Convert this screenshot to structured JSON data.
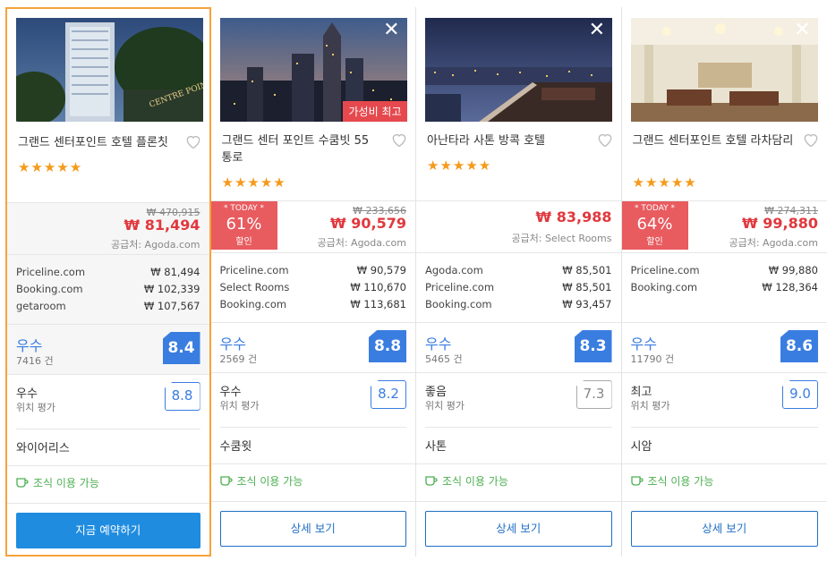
{
  "hotels": [
    {
      "name": "그랜드 센터포인트 호텔 플론칫",
      "stars": "★★★★★",
      "old_price": "₩ 470,915",
      "price": "₩ 81,494",
      "supplier": "공급처: Agoda.com",
      "today": null,
      "alts": [
        {
          "site": "Priceline.com",
          "price": "₩   81,494"
        },
        {
          "site": "Booking.com",
          "price": "₩  102,339"
        },
        {
          "site": "getaroom",
          "price": "₩  107,567"
        }
      ],
      "rating_label": "우수",
      "rating_count": "7416 건",
      "rating_score": "8.4",
      "location_label": "우수",
      "location_sub": "위치 평가",
      "location_score": "8.8",
      "area": "와이어리스",
      "breakfast": "조식 이용 가능",
      "button": "지금 예약하기",
      "photo": "hotel-tower-night"
    },
    {
      "name": "그랜드 센터 포인트 수쿰빗 55 통로",
      "stars": "★★★★★",
      "old_price": "₩ 233,656",
      "price": "₩ 90,579",
      "supplier": "공급처: Agoda.com",
      "badge": "가성비 최고",
      "today": {
        "top": "* TODAY *",
        "pct": "61%",
        "label": "할인"
      },
      "alts": [
        {
          "site": "Priceline.com",
          "price": "₩   90,579"
        },
        {
          "site": "Select Rooms",
          "price": "₩  110,670"
        },
        {
          "site": "Booking.com",
          "price": "₩  113,681"
        }
      ],
      "rating_label": "우수",
      "rating_count": "2569 건",
      "rating_score": "8.8",
      "location_label": "우수",
      "location_sub": "위치 평가",
      "location_score": "8.2",
      "area": "수쿰윗",
      "breakfast": "조식 이용 가능",
      "button": "상세 보기",
      "photo": "city-skyline-dusk"
    },
    {
      "name": "아난타라 사톤 방콕 호텔",
      "stars": "★★★★★",
      "old_price": "",
      "price": "₩ 83,988",
      "supplier": "공급처: Select Rooms",
      "today": null,
      "alts": [
        {
          "site": "Agoda.com",
          "price": "₩   85,501"
        },
        {
          "site": "Priceline.com",
          "price": "₩   85,501"
        },
        {
          "site": "Booking.com",
          "price": "₩   93,457"
        }
      ],
      "rating_label": "우수",
      "rating_count": "5465 건",
      "rating_score": "8.3",
      "location_label": "좋음",
      "location_sub": "위치 평가",
      "location_score": "7.3",
      "area": "사톤",
      "breakfast": "조식 이용 가능",
      "button": "상세 보기",
      "photo": "rooftop-bar-night"
    },
    {
      "name": "그랜드 센터포인트 호텔 라차담리",
      "stars": "★★★★★",
      "old_price": "₩ 274,311",
      "price": "₩ 99,880",
      "supplier": "공급처: Agoda.com",
      "today": {
        "top": "* TODAY *",
        "pct": "64%",
        "label": "할인"
      },
      "alts": [
        {
          "site": "Priceline.com",
          "price": "₩   99,880"
        },
        {
          "site": "Booking.com",
          "price": "₩  128,364"
        }
      ],
      "rating_label": "우수",
      "rating_count": "11790 건",
      "rating_score": "8.6",
      "location_label": "최고",
      "location_sub": "위치 평가",
      "location_score": "9.0",
      "area": "시암",
      "breakfast": "조식 이용 가능",
      "button": "상세 보기",
      "photo": "hotel-lobby"
    }
  ],
  "colors": {
    "accent": "#1f8ce0",
    "price_red": "#e0393e",
    "star": "#f59a1b",
    "rating_blue": "#3a7de0",
    "breakfast_green": "#4caf50",
    "today_red": "#e85b5f"
  }
}
